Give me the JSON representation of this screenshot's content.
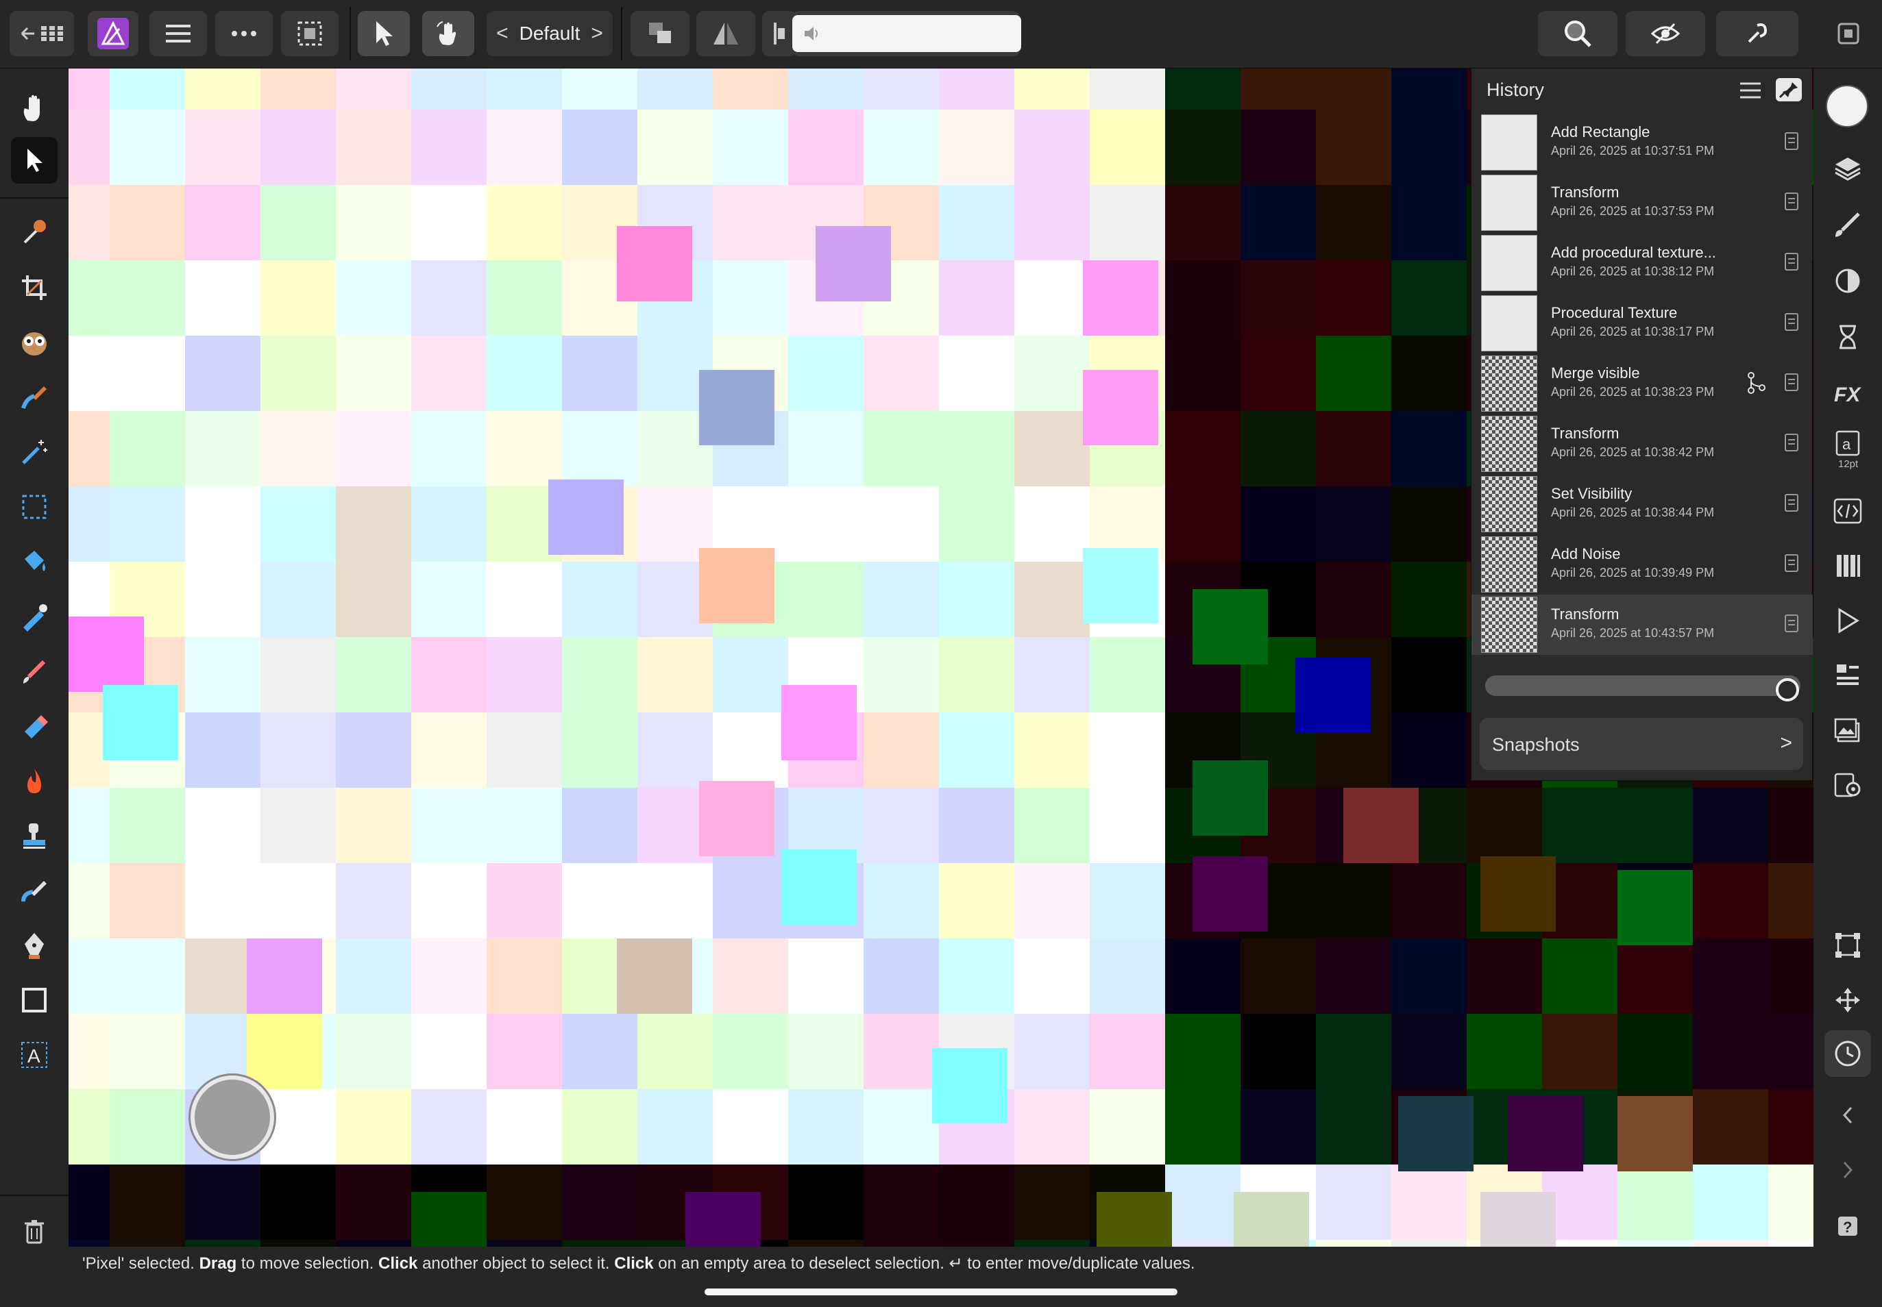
{
  "toolbar": {
    "persona_label": "Default",
    "persona_prev": "<",
    "persona_next": ">"
  },
  "history": {
    "title": "History",
    "entries": [
      {
        "name": "Add Rectangle",
        "date": "April 26, 2025 at 10:37:51 PM",
        "thumb": "plain"
      },
      {
        "name": "Transform",
        "date": "April 26, 2025 at 10:37:53 PM",
        "thumb": "plain"
      },
      {
        "name": "Add procedural texture...",
        "date": "April 26, 2025 at 10:38:12 PM",
        "thumb": "plain"
      },
      {
        "name": "Procedural Texture",
        "date": "April 26, 2025 at 10:38:17 PM",
        "thumb": "plain"
      },
      {
        "name": "Merge visible",
        "date": "April 26, 2025 at 10:38:23 PM",
        "thumb": "checker"
      },
      {
        "name": "Transform",
        "date": "April 26, 2025 at 10:38:42 PM",
        "thumb": "checker"
      },
      {
        "name": "Set Visibility",
        "date": "April 26, 2025 at 10:38:44 PM",
        "thumb": "checker"
      },
      {
        "name": "Add Noise",
        "date": "April 26, 2025 at 10:39:49 PM",
        "thumb": "checker"
      },
      {
        "name": "Transform",
        "date": "April 26, 2025 at 10:43:57 PM",
        "thumb": "checker"
      }
    ],
    "selected_index": 8,
    "snapshots_label": "Snapshots",
    "snapshots_chevron": ">"
  },
  "studio": {
    "font_size_hint": "12pt"
  },
  "status": {
    "part1": "'Pixel' selected. ",
    "bold1": "Drag",
    "part2": " to move selection. ",
    "bold2": "Click",
    "part3": " another object to select it. ",
    "bold3": "Click",
    "part4": " on an empty area to deselect selection. ↵ to enter move/duplicate values."
  },
  "colors": {
    "accent_app_icon": "#9b3fd0",
    "panel_bg": "#2a2a2a",
    "toolbar_bg": "#262626",
    "primary_color_swatch": "#f2f2f2"
  },
  "canvas_palette": {
    "light": [
      "#ffffff",
      "#e6ffff",
      "#d0d4ff",
      "#fff0fa",
      "#ffffff",
      "#e6ffff",
      "#e9dccd",
      "#ffffff",
      "#ffffff",
      "#e4e4ff",
      "#fff5f0",
      "#d4ffd9",
      "#ffe6e4",
      "#d2ffd4",
      "#f8ffe8"
    ],
    "dark": [
      "#0a1a04",
      "#004a00",
      "#3a1808",
      "#07061c",
      "#1a0c00",
      "#000000",
      "#04001a",
      "#2a0408"
    ]
  }
}
